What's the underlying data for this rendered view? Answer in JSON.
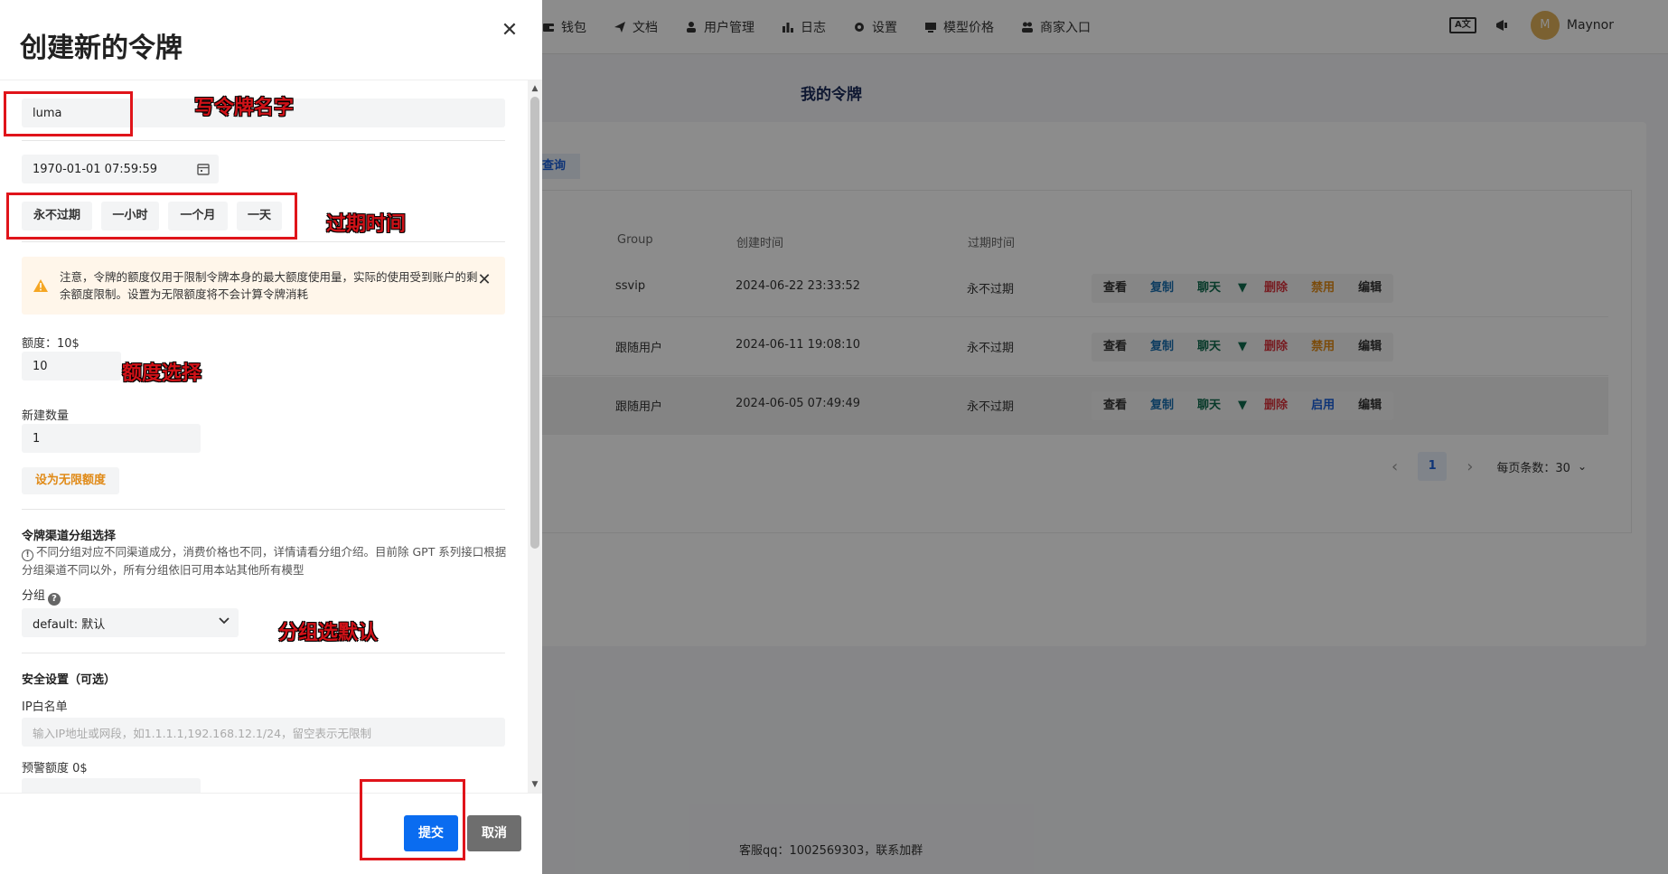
{
  "nav": {
    "items": [
      {
        "label": "钱包",
        "icon": "wallet-icon"
      },
      {
        "label": "文档",
        "icon": "send-icon"
      },
      {
        "label": "用户管理",
        "icon": "user-icon"
      },
      {
        "label": "日志",
        "icon": "chart-icon"
      },
      {
        "label": "设置",
        "icon": "gear-icon"
      },
      {
        "label": "模型价格",
        "icon": "price-icon"
      },
      {
        "label": "商家入口",
        "icon": "merchant-icon"
      }
    ],
    "lang_label": "A文",
    "user_initial": "M",
    "user_name": "Maynor"
  },
  "page": {
    "title": "我的令牌",
    "search_tab": "查询",
    "headers": {
      "group": "Group",
      "created": "创建时间",
      "expire": "过期时间"
    },
    "rows": [
      {
        "group": "ssvip",
        "created": "2024-06-22 23:33:52",
        "expire": "永不过期",
        "toggle": "禁用"
      },
      {
        "group": "跟随用户",
        "created": "2024-06-11 19:08:10",
        "expire": "永不过期",
        "toggle": "禁用"
      },
      {
        "group": "跟随用户",
        "created": "2024-06-05 07:49:49",
        "expire": "永不过期",
        "toggle": "启用"
      }
    ],
    "actions": {
      "view": "查看",
      "copy": "复制",
      "chat": "聊天",
      "delete": "删除",
      "edit": "编辑"
    },
    "pager": {
      "current": "1",
      "per_page": "每页条数：30"
    },
    "footer": "客服qq：1002569303，联系加群"
  },
  "sheet": {
    "title": "创建新的令牌",
    "name_value": "luma",
    "expire_value": "1970-01-01 07:59:59",
    "expire_chips": [
      "永不过期",
      "一小时",
      "一个月",
      "一天"
    ],
    "warning": "注意，令牌的额度仅用于限制令牌本身的最大额度使用量，实际的使用受到账户的剩余额度限制。设置为无限额度将不会计算令牌消耗",
    "quota_label": "额度：10$",
    "quota_value": "10",
    "count_label": "新建数量",
    "count_value": "1",
    "unlimited_btn": "设为无限额度",
    "group_section_title": "令牌渠道分组选择",
    "group_hint": "不同分组对应不同渠道成分，消费价格也不同，详情请看分组介绍。目前除 GPT 系列接口根据分组渠道不同以外，所有分组依旧可用本站其他所有模型",
    "group_label": "分组",
    "group_value": "default: 默认",
    "security_title": "安全设置（可选）",
    "ip_label": "IP白名单",
    "ip_placeholder": "输入IP地址或网段，如1.1.1.1,192.168.12.1/24，留空表示无限制",
    "alert_label": "预警额度 0$",
    "submit": "提交",
    "cancel": "取消"
  },
  "annotations": {
    "name": "写令牌名字",
    "expire": "过期时间",
    "quota": "额度选择",
    "group": "分组选默认"
  },
  "colors": {
    "primary": "#0a6cf0",
    "annotation": "#e0141a",
    "warning_bg": "#fff6ea",
    "warning_icon": "#f5a623"
  }
}
